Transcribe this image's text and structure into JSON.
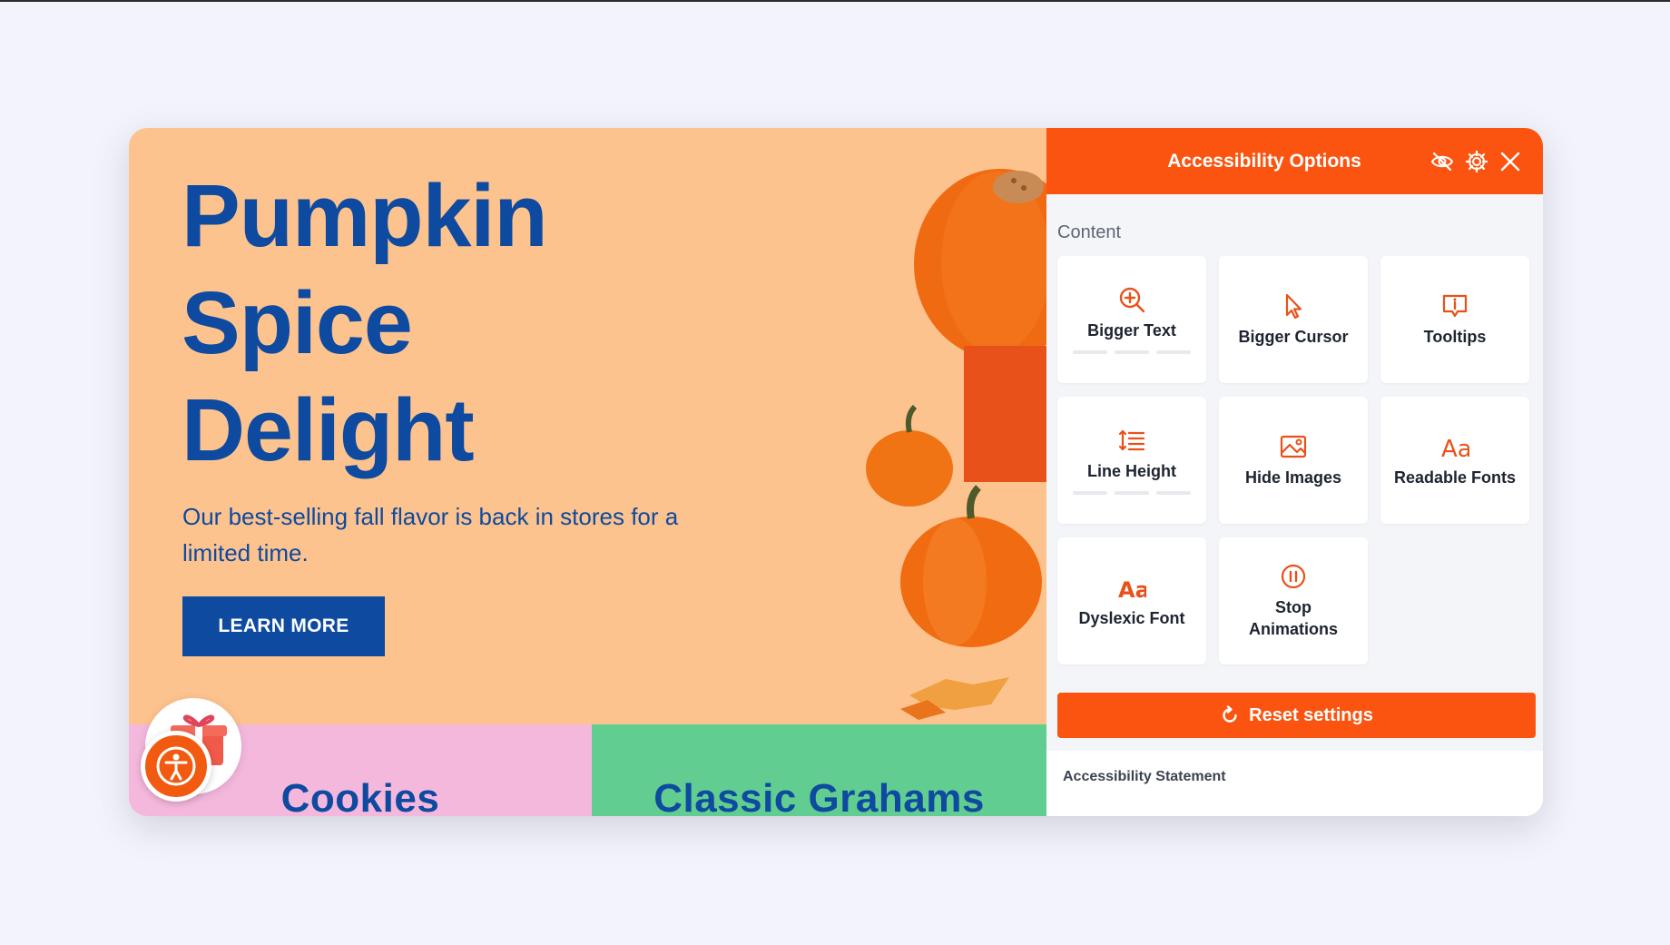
{
  "hero": {
    "title_lines": [
      "Pumpkin",
      "Spice",
      "Delight"
    ],
    "subtitle": "Our best-selling fall flavor is back in stores for a limited time.",
    "cta_label": "LEARN MORE"
  },
  "categories": [
    {
      "label": "Cookies",
      "color": "#f5b8dd"
    },
    {
      "label": "Classic Grahams",
      "color": "#62cd90"
    }
  ],
  "panel": {
    "title": "Accessibility Options",
    "header_icons": [
      "hide-eye-icon",
      "gear-icon",
      "close-icon"
    ],
    "section_label": "Content",
    "tiles": [
      {
        "label": "Bigger Text",
        "icon": "zoom-in-icon",
        "levels": 3
      },
      {
        "label": "Bigger Cursor",
        "icon": "cursor-icon"
      },
      {
        "label": "Tooltips",
        "icon": "tooltip-icon"
      },
      {
        "label": "Line Height",
        "icon": "line-height-icon",
        "levels": 3
      },
      {
        "label": "Hide Images",
        "icon": "image-icon"
      },
      {
        "label": "Readable Fonts",
        "icon": "font-aa-icon"
      },
      {
        "label": "Dyslexic Font",
        "icon": "font-aa-icon"
      },
      {
        "label": "Stop Animations",
        "icon": "pause-icon"
      }
    ],
    "reset_label": "Reset settings",
    "statement_label": "Accessibility Statement"
  },
  "colors": {
    "accent": "#fa5410",
    "hero_bg": "#fdc38e",
    "brand_blue": "#0d4aa0",
    "panel_bg": "#f4f5f9"
  }
}
